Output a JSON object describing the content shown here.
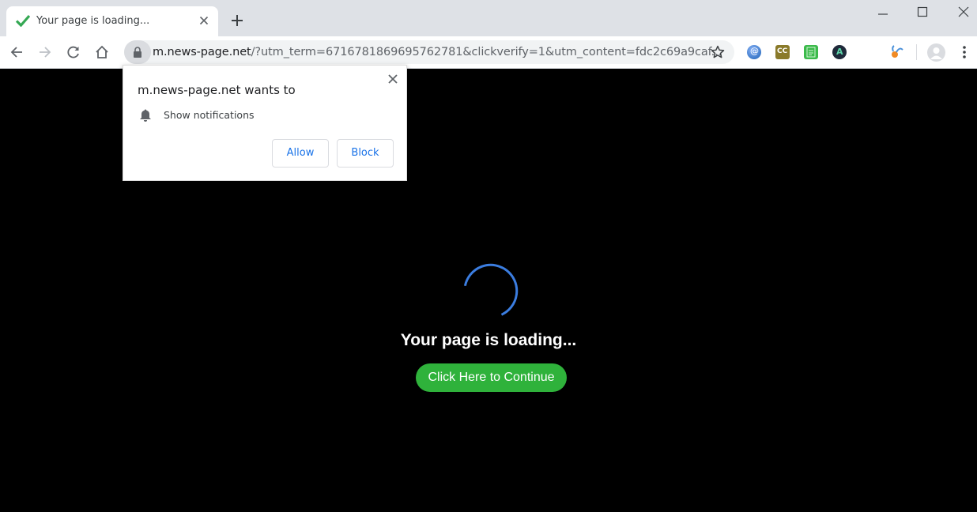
{
  "browser": {
    "tab": {
      "title": "Your page is loading...",
      "favicon": "green-checkmark-icon"
    },
    "new_tab_label": "+",
    "window_controls": [
      "minimize",
      "maximize",
      "close"
    ],
    "address": {
      "host": "m.news-page.net",
      "rest": "/?utm_term=6716781869695762781&clickverify=1&utm_content=fdc2c69a9caf..."
    },
    "extensions": [
      "at-sign-extension-icon",
      "cc-extension-icon",
      "green-doc-extension-icon",
      "a-circle-extension-icon",
      "bird-extension-icon"
    ]
  },
  "permission_popup": {
    "title": "m.news-page.net wants to",
    "permission": "Show notifications",
    "allow_label": "Allow",
    "block_label": "Block"
  },
  "page": {
    "loading_text": "Your page is loading...",
    "continue_label": "Click Here to Continue",
    "colors": {
      "background": "#000000",
      "spinner": "#3b7de0",
      "button": "#2fb23b"
    }
  }
}
